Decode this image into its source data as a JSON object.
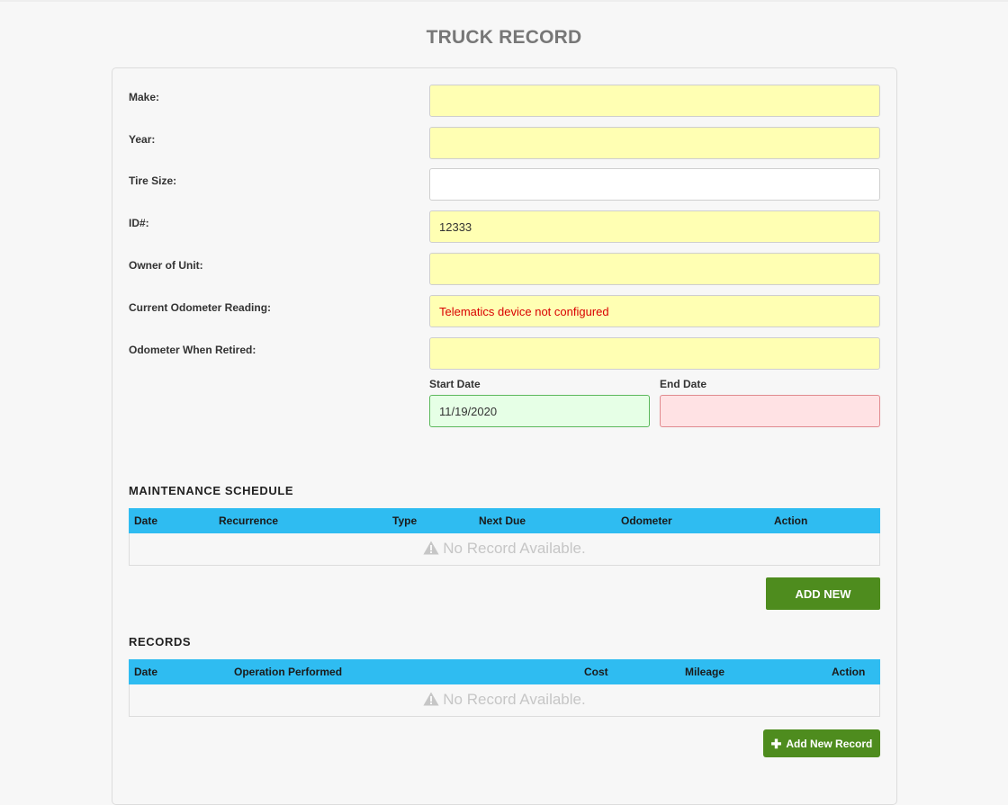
{
  "page": {
    "title": "TRUCK RECORD"
  },
  "form": {
    "fields": [
      {
        "label": "Make:",
        "value": "",
        "style": "yellow"
      },
      {
        "label": "Year:",
        "value": "",
        "style": "yellow"
      },
      {
        "label": "Tire Size:",
        "value": "",
        "style": "white"
      },
      {
        "label": "ID#:",
        "value": "12333",
        "style": "yellow"
      },
      {
        "label": "Owner of Unit:",
        "value": "",
        "style": "yellow"
      },
      {
        "label": "Current Odometer Reading:",
        "value": "Telematics device not configured",
        "style": "yellow-error"
      },
      {
        "label": "Odometer When Retired:",
        "value": "",
        "style": "yellow"
      }
    ],
    "start_date": {
      "label": "Start Date",
      "value": "11/19/2020"
    },
    "end_date": {
      "label": "End Date",
      "value": ""
    }
  },
  "maintenance": {
    "title": "MAINTENANCE SCHEDULE",
    "columns": [
      "Date",
      "Recurrence",
      "Type",
      "Next Due",
      "Odometer",
      "Action"
    ],
    "empty_text": "No Record Available.",
    "add_button": "ADD NEW"
  },
  "records": {
    "title": "RECORDS",
    "columns": [
      "Date",
      "Operation Performed",
      "Cost",
      "Mileage",
      "Action"
    ],
    "empty_text": "No Record Available.",
    "add_button": "Add New Record"
  },
  "colors": {
    "header_blue": "#2fbcf1",
    "button_green": "#4e8c1e",
    "required_yellow": "#ffffb3",
    "start_green": "#e6ffe6",
    "end_red": "#ffe2e4",
    "error_red": "#d90000"
  },
  "icons": {
    "empty": "warning-icon",
    "add_record": "plus-icon"
  }
}
